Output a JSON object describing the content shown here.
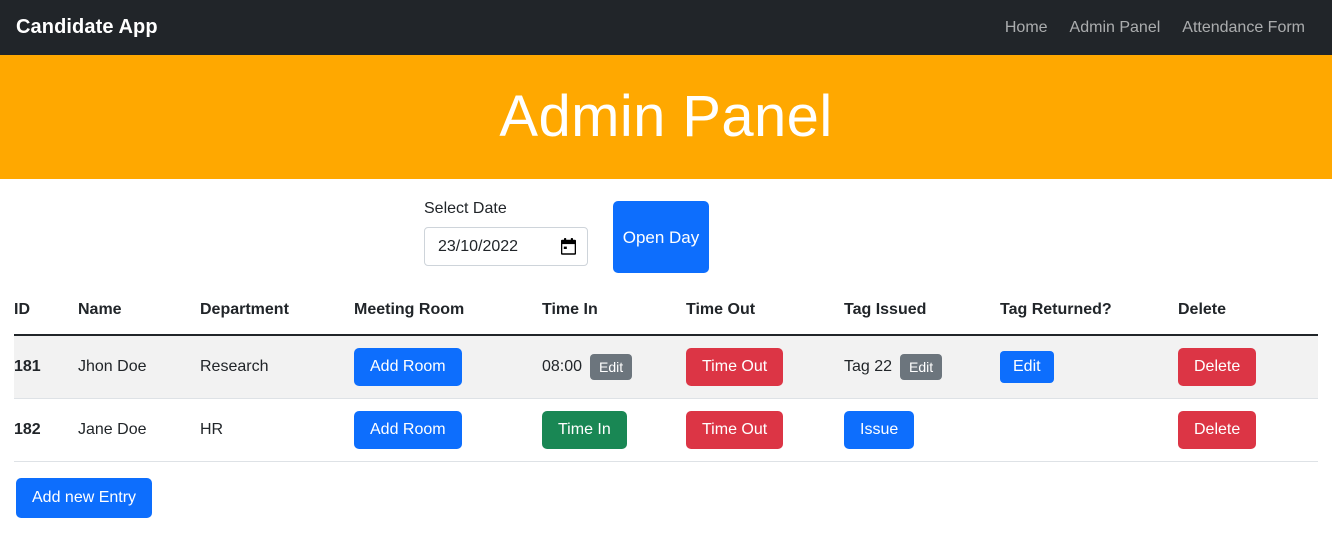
{
  "navbar": {
    "brand": "Candidate App",
    "links": [
      {
        "label": "Home",
        "name": "nav-link-home"
      },
      {
        "label": "Admin Panel",
        "name": "nav-link-admin-panel"
      },
      {
        "label": "Attendance Form",
        "name": "nav-link-attendance-form"
      }
    ]
  },
  "banner": {
    "title": "Admin Panel",
    "background": "#FFA800"
  },
  "controls": {
    "date_label": "Select Date",
    "date_value": "23/10/2022",
    "date_placeholder": "dd/mm/yyyy",
    "open_day_label": "Open Day"
  },
  "table": {
    "headers": [
      "ID",
      "Name",
      "Department",
      "Meeting Room",
      "Time In",
      "Time Out",
      "Tag Issued",
      "Tag Returned?",
      "Delete"
    ],
    "rows": [
      {
        "id": "181",
        "name": "Jhon Doe",
        "department": "Research",
        "meeting_room_label": "Add Room",
        "time_in_value": "08:00",
        "time_in_edit_label": "Edit",
        "time_out_label": "Time Out",
        "tag_issued_value": "Tag 22",
        "tag_issued_edit_label": "Edit",
        "tag_returned_label": "Edit",
        "delete_label": "Delete"
      },
      {
        "id": "182",
        "name": "Jane Doe",
        "department": "HR",
        "meeting_room_label": "Add Room",
        "time_in_label": "Time In",
        "time_out_label": "Time Out",
        "tag_issued_label": "Issue",
        "tag_returned_label": "",
        "delete_label": "Delete"
      }
    ]
  },
  "footer": {
    "add_new_entry_label": "Add new Entry"
  },
  "colors": {
    "navbar_bg": "#212529",
    "banner_bg": "#FFA800",
    "primary": "#0d6efd",
    "danger": "#DC3545",
    "success": "#198754",
    "secondary": "#6c757d",
    "row_stripe": "#f2f2f2"
  }
}
